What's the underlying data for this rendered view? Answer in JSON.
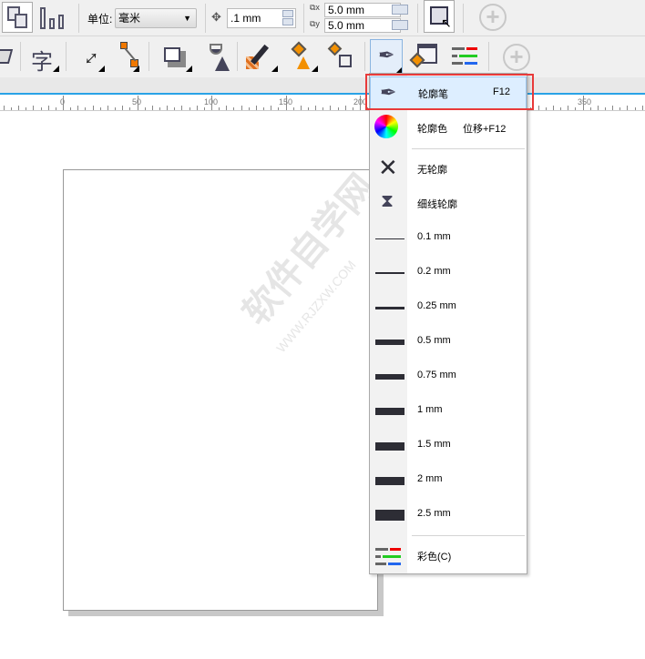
{
  "toolbar1": {
    "unit_label": "单位:",
    "unit_value": "毫米",
    "nudge_value": ".1 mm",
    "dup_x": "5.0 mm",
    "dup_y": "5.0 mm"
  },
  "ruler": {
    "ticks": [
      "0",
      "50",
      "100",
      "150",
      "200",
      "350"
    ]
  },
  "menu": {
    "items": [
      {
        "label": "轮廓笔",
        "shortcut": "F12"
      },
      {
        "label": "轮廓色",
        "shortcut": "位移+F12"
      },
      {
        "label": "无轮廓"
      },
      {
        "label": "细线轮廓"
      },
      {
        "label": "0.1 mm"
      },
      {
        "label": "0.2 mm"
      },
      {
        "label": "0.25 mm"
      },
      {
        "label": "0.5 mm"
      },
      {
        "label": "0.75 mm"
      },
      {
        "label": "1 mm"
      },
      {
        "label": "1.5 mm"
      },
      {
        "label": "2 mm"
      },
      {
        "label": "2.5 mm"
      },
      {
        "label": "彩色(C)"
      }
    ]
  },
  "watermark": {
    "text": "软件自学网",
    "url": "WWW.RJZXW.COM"
  },
  "colors": {
    "highlight": "#e83a3a",
    "menu_hover": "#ddeeff",
    "ruler_accent": "#29a3e6"
  }
}
